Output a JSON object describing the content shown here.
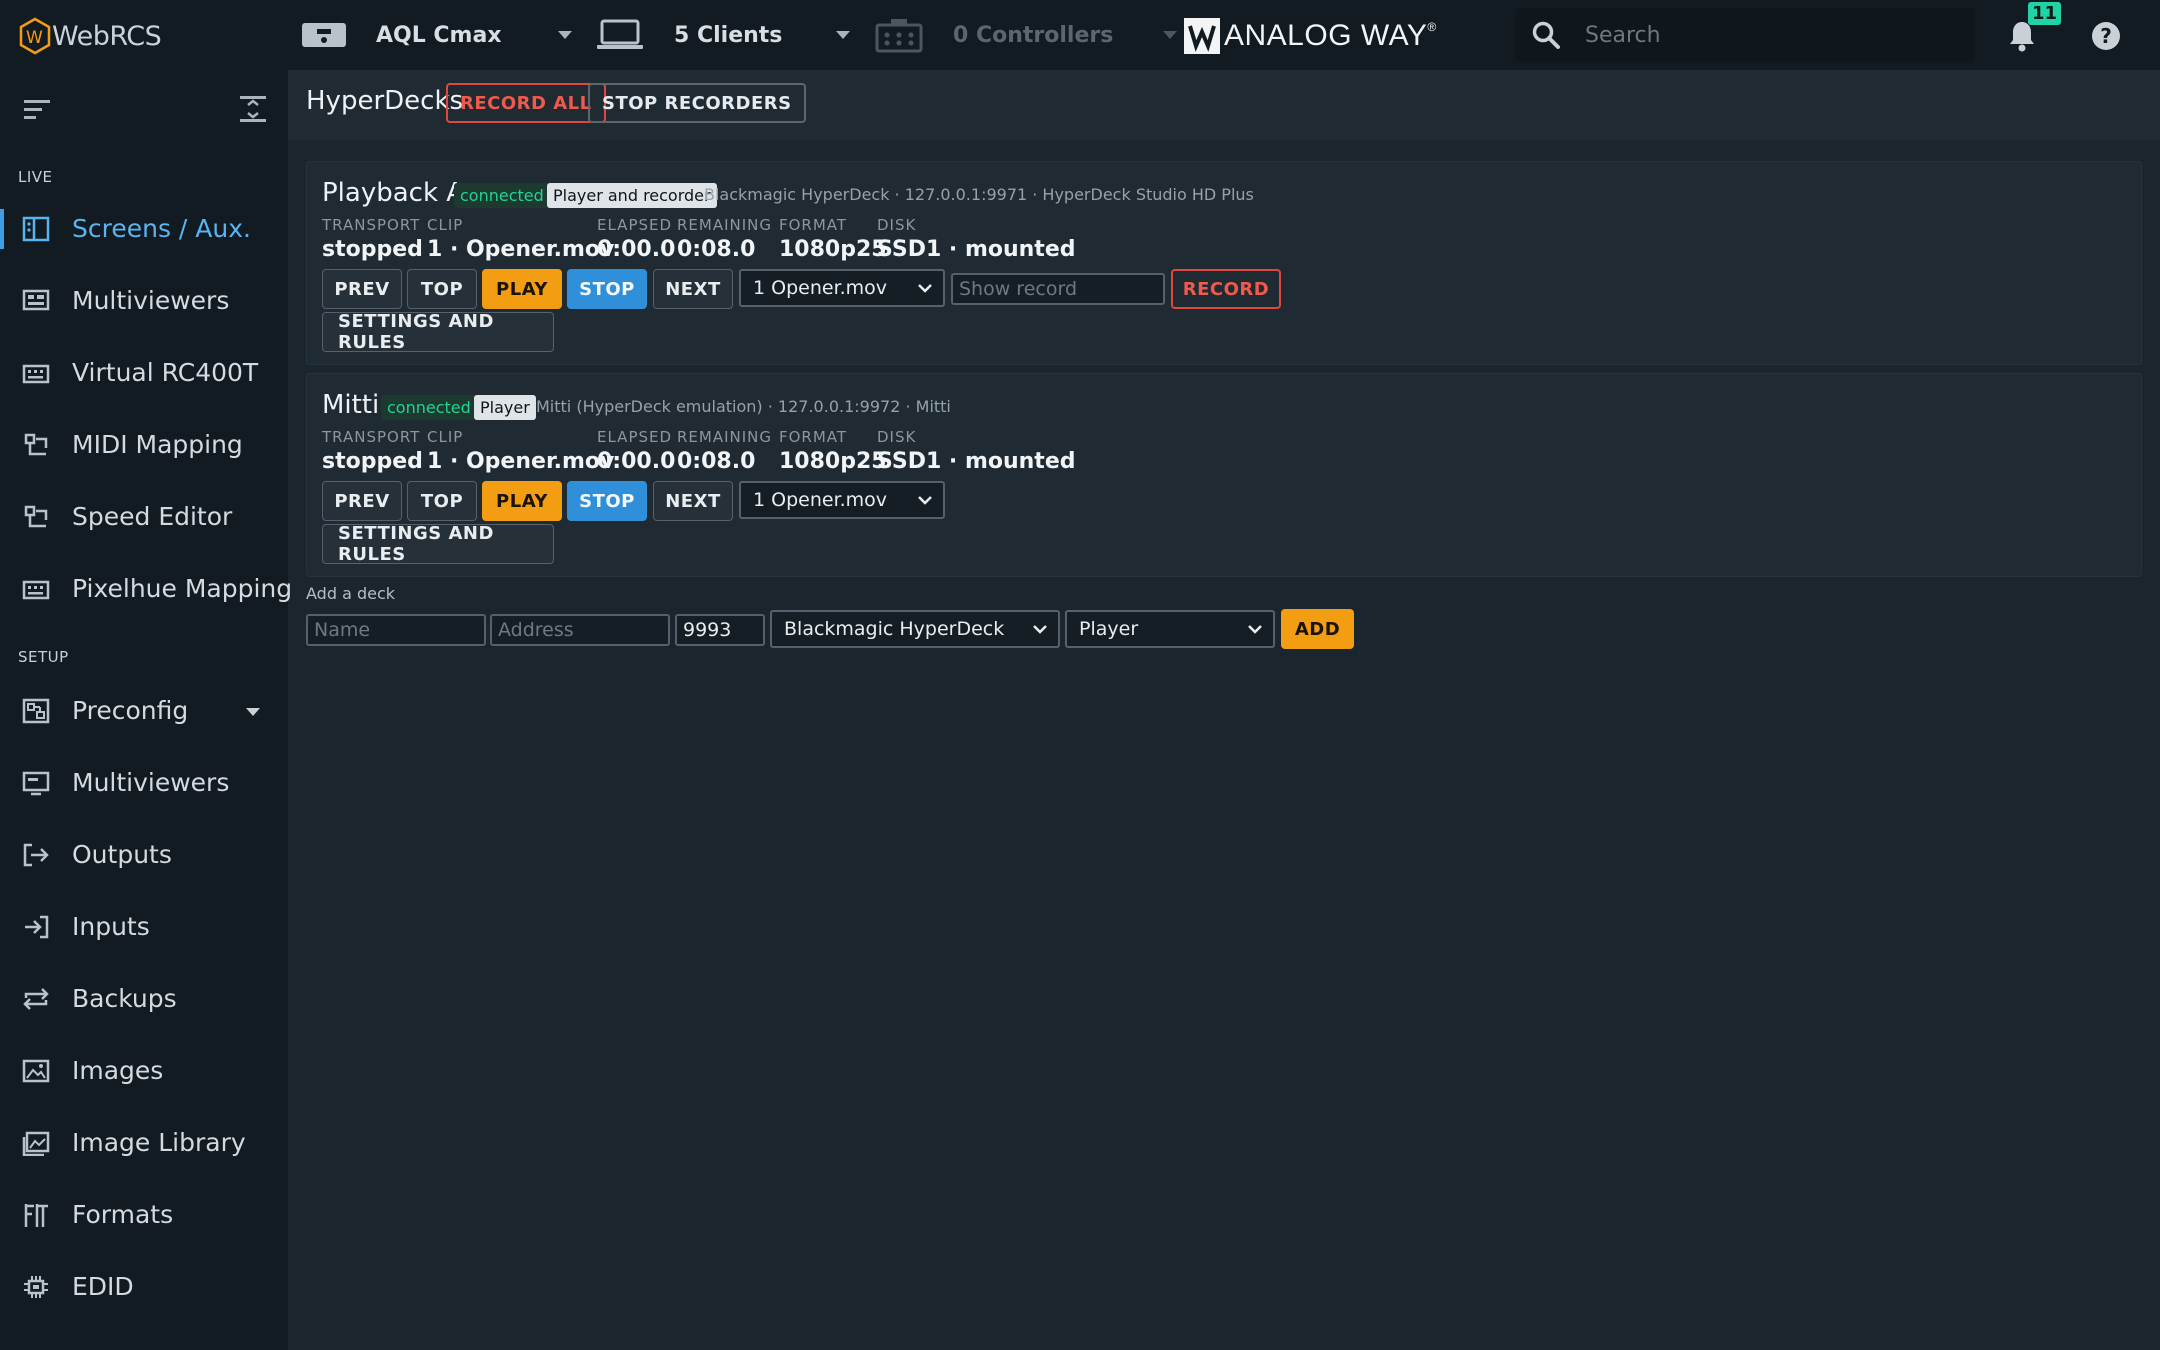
{
  "app": {
    "name": "WebRCS"
  },
  "topbar": {
    "device": "AQL Cmax",
    "clients": "5 Clients",
    "controllers": "0 Controllers",
    "brand": "ANALOG WAY",
    "search_placeholder": "Search",
    "notifications_count": "11"
  },
  "sidebar": {
    "live_label": "LIVE",
    "setup_label": "SETUP",
    "live_items": [
      {
        "label": "Screens / Aux.",
        "icon": "screens-icon",
        "active": true
      },
      {
        "label": "Multiviewers",
        "icon": "multiviewer-icon"
      },
      {
        "label": "Virtual RC400T",
        "icon": "keyboard-icon"
      },
      {
        "label": "MIDI Mapping",
        "icon": "mapping-icon"
      },
      {
        "label": "Speed Editor",
        "icon": "mapping-icon"
      },
      {
        "label": "Pixelhue Mapping",
        "icon": "keyboard-icon"
      }
    ],
    "setup_items": [
      {
        "label": "Preconfig",
        "icon": "preconfig-icon",
        "has_submenu": true
      },
      {
        "label": "Multiviewers",
        "icon": "multiviewer-setup-icon"
      },
      {
        "label": "Outputs",
        "icon": "outputs-icon"
      },
      {
        "label": "Inputs",
        "icon": "inputs-icon"
      },
      {
        "label": "Backups",
        "icon": "backups-icon"
      },
      {
        "label": "Images",
        "icon": "image-icon"
      },
      {
        "label": "Image Library",
        "icon": "image-library-icon"
      },
      {
        "label": "Formats",
        "icon": "formats-icon"
      },
      {
        "label": "EDID",
        "icon": "chip-icon"
      }
    ]
  },
  "page": {
    "title": "HyperDecks",
    "record_all": "RECORD ALL",
    "stop_recorders": "STOP RECORDERS"
  },
  "labels": {
    "transport": "TRANSPORT",
    "clip": "CLIP",
    "elapsed": "ELAPSED",
    "remaining": "REMAINING",
    "format": "FORMAT",
    "disk": "DISK",
    "prev": "PREV",
    "top": "TOP",
    "play": "PLAY",
    "stop": "STOP",
    "next": "NEXT",
    "record": "RECORD",
    "settings": "SETTINGS AND RULES",
    "show_record_placeholder": "Show record"
  },
  "decks": [
    {
      "name": "Playback A",
      "status": "connected",
      "role": "Player and recorder",
      "meta": "Blackmagic HyperDeck · 127.0.0.1:9971 · HyperDeck Studio HD Plus",
      "transport": "stopped",
      "clip": "1 · Opener.mov",
      "elapsed": "0:00.0",
      "remaining": "0:08.0",
      "format": "1080p25",
      "disk": "SSD1 · mounted",
      "clip_select": "1 Opener.mov"
    },
    {
      "name": "Mitti",
      "status": "connected",
      "role": "Player",
      "meta": "Mitti (HyperDeck emulation) · 127.0.0.1:9972 · Mitti",
      "transport": "stopped",
      "clip": "1 · Opener.mov",
      "elapsed": "0:00.0",
      "remaining": "0:08.0",
      "format": "1080p25",
      "disk": "SSD1 · mounted",
      "clip_select": "1 Opener.mov"
    }
  ],
  "add_deck": {
    "label": "Add a deck",
    "name_placeholder": "Name",
    "address_placeholder": "Address",
    "port_value": "9993",
    "type_value": "Blackmagic HyperDeck",
    "role_value": "Player",
    "add_label": "ADD"
  },
  "colors": {
    "accent_orange": "#f39d12",
    "accent_blue": "#2f8fd8",
    "record_red": "#e0483c",
    "connected_green": "#22d391"
  }
}
